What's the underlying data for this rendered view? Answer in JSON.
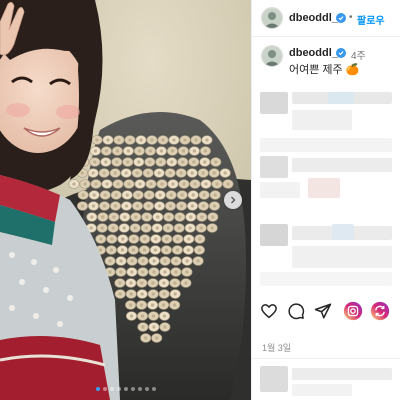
{
  "header": {
    "username": "dbeoddl_",
    "separator": "•",
    "follow_label": "팔로우"
  },
  "caption": {
    "username": "dbeoddl_",
    "time_ago": "4주",
    "text": "어여쁜 제주 🍊"
  },
  "actions": {
    "like": "heart-icon",
    "comment": "comment-icon",
    "share": "send-icon",
    "icon_4": "instagram-badge-icon",
    "icon_5": "repost-badge-icon"
  },
  "post_date": "1월 3일",
  "carousel": {
    "total": 9,
    "active_index": 0
  },
  "colors": {
    "accent": "#0095f6",
    "verified": "#3897f0",
    "badge_gradient": [
      "#feda75",
      "#d62976",
      "#962fbf"
    ]
  }
}
